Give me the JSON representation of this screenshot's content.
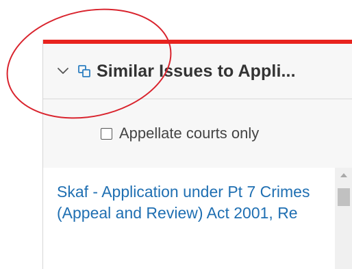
{
  "panel": {
    "accent_color": "#e8231e",
    "header": {
      "expand_icon": "chevron-down-icon",
      "related_icon": "related-documents-icon",
      "title": "Similar Issues to Appli..."
    },
    "filter": {
      "checkbox_checked": false,
      "label": "Appellate courts only"
    },
    "results": [
      {
        "title": "Skaf - Application under Pt 7 Crimes (Appeal and Review) Act 2001, Re"
      }
    ],
    "link_color": "#1f6fb2"
  },
  "annotation": {
    "shape": "ellipse",
    "color": "#d9232d"
  }
}
